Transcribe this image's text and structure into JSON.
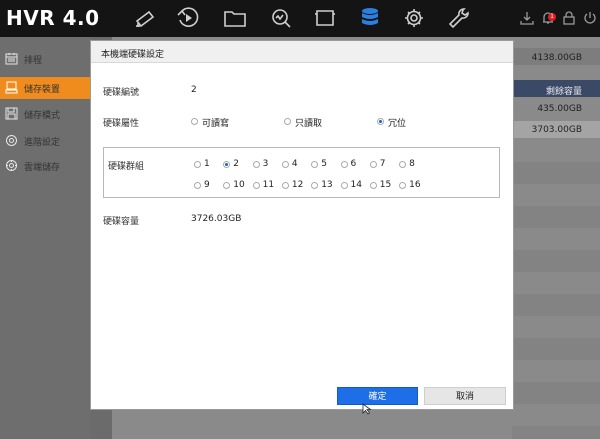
{
  "app": {
    "logo": "HVR 4.0"
  },
  "topbar": {
    "icons": [
      "camera-icon",
      "playback-icon",
      "folder-icon",
      "search-icon",
      "monitor-icon",
      "storage-icon",
      "settings-icon",
      "wrench-icon"
    ],
    "right_icons": [
      "download-icon",
      "alarm-bell-icon",
      "lock-icon",
      "power-icon"
    ],
    "alarm_count": "1"
  },
  "sidebar": {
    "items": [
      {
        "label": "排程",
        "icon": "calendar-icon",
        "active": false
      },
      {
        "label": "儲存裝置",
        "icon": "storage-device-icon",
        "active": true
      },
      {
        "label": "儲存模式",
        "icon": "save-icon",
        "active": false
      },
      {
        "label": "進階設定",
        "icon": "gear-icon",
        "active": false
      },
      {
        "label": "雲端儲存",
        "icon": "cloud-gear-icon",
        "active": false
      }
    ]
  },
  "background_table": {
    "total": "4138.00GB",
    "header": "剩餘容量",
    "rows": [
      "435.00GB",
      "3703.00GB"
    ]
  },
  "dialog": {
    "title": "本機端硬碟設定",
    "disk_number_label": "硬碟編號",
    "disk_number_value": "2",
    "attribute_label": "硬碟屬性",
    "attribute_options": [
      "可讀寫",
      "只讀取",
      "冗位"
    ],
    "attribute_selected": "冗位",
    "group_label": "硬碟群組",
    "group_options": [
      "1",
      "2",
      "3",
      "4",
      "5",
      "6",
      "7",
      "8",
      "9",
      "10",
      "11",
      "12",
      "13",
      "14",
      "15",
      "16"
    ],
    "group_selected": "2",
    "capacity_label": "硬碟容量",
    "capacity_value": "3726.03GB",
    "ok_label": "確定",
    "cancel_label": "取消"
  },
  "colors": {
    "accent": "#f08c1e",
    "primary_button": "#1e6ee8",
    "topbar": "#141414"
  }
}
